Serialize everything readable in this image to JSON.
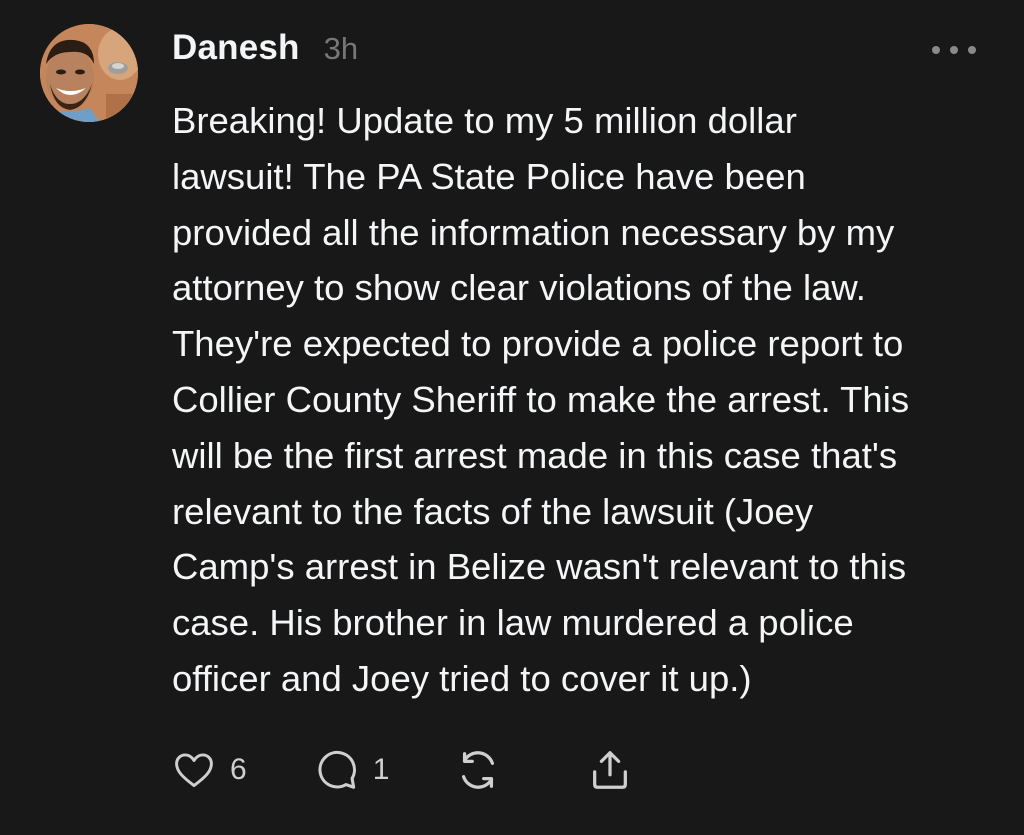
{
  "post": {
    "avatar_icon": "user-avatar-photo",
    "username": "Danesh",
    "time_ago": "3h",
    "more_icon": "more-options-icon",
    "text": "Breaking! Update to my 5 million dollar\nlawsuit! The PA State Police have been\nprovided all the information necessary by my\nattorney to show clear violations of the law.\nThey're expected to provide a police report to\nCollier County Sheriff to make the arrest. This\nwill be the first arrest made in this case that's\nrelevant to the facts of the lawsuit (Joey\nCamp's arrest in Belize wasn't relevant to this\ncase. His brother in law murdered a police\nofficer and Joey tried to cover it up.)"
  },
  "actions": {
    "like": {
      "icon": "heart-icon",
      "count": "6"
    },
    "reply": {
      "icon": "comment-icon",
      "count": "1"
    },
    "repost": {
      "icon": "repost-icon"
    },
    "share": {
      "icon": "share-icon"
    }
  },
  "colors": {
    "background": "#181818",
    "text_primary": "#f3f5f7",
    "text_secondary": "#777777"
  }
}
